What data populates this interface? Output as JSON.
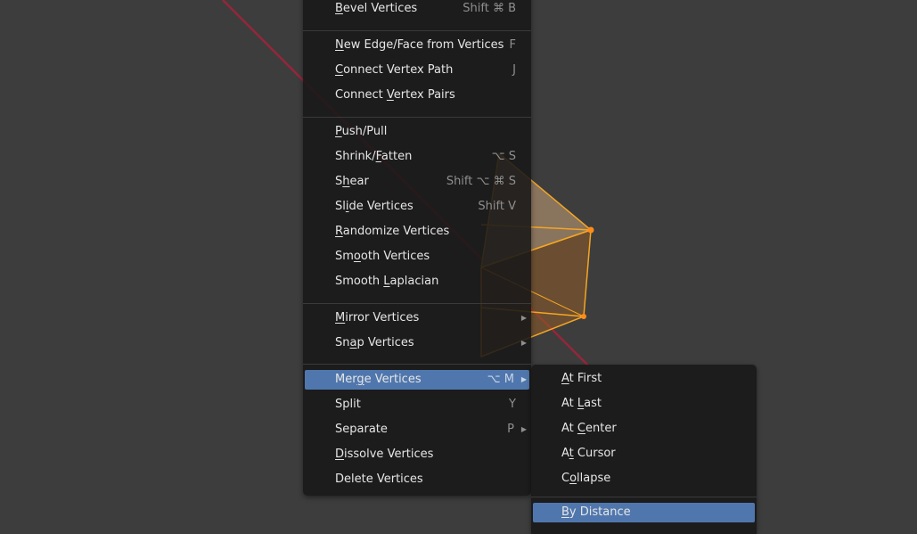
{
  "viewport": {
    "background": "#3d3d3d",
    "axis_color": "#a0243a",
    "mesh_color": "#f5a623"
  },
  "main_menu": {
    "items": [
      {
        "label": "Bevel Vertices",
        "mnemonic": "B",
        "shortcut": "Shift ⌘ B"
      },
      {
        "label": "New Edge/Face from Vertices",
        "mnemonic": "N",
        "shortcut": "F"
      },
      {
        "label": "Connect Vertex Path",
        "mnemonic": "C",
        "shortcut": "J"
      },
      {
        "label": "Connect Vertex Pairs",
        "mnemonic": "V",
        "shortcut": ""
      },
      {
        "label": "Push/Pull",
        "mnemonic": "P",
        "shortcut": ""
      },
      {
        "label": "Shrink/Fatten",
        "mnemonic": "F",
        "shortcut": "⌥ S"
      },
      {
        "label": "Shear",
        "mnemonic": "h",
        "shortcut": "Shift ⌥ ⌘ S"
      },
      {
        "label": "Slide Vertices",
        "mnemonic": "i",
        "shortcut": "Shift V"
      },
      {
        "label": "Randomize Vertices",
        "mnemonic": "R",
        "shortcut": ""
      },
      {
        "label": "Smooth Vertices",
        "mnemonic": "o",
        "shortcut": ""
      },
      {
        "label": "Smooth Laplacian",
        "mnemonic": "L",
        "shortcut": ""
      },
      {
        "label": "Mirror Vertices",
        "mnemonic": "M",
        "shortcut": "",
        "submenu": true
      },
      {
        "label": "Snap Vertices",
        "mnemonic": "a",
        "shortcut": "",
        "submenu": true
      },
      {
        "label": "Merge Vertices",
        "mnemonic": "g",
        "shortcut": "⌥ M",
        "submenu": true,
        "active": true
      },
      {
        "label": "Split",
        "mnemonic": "",
        "shortcut": "Y"
      },
      {
        "label": "Separate",
        "mnemonic": "",
        "shortcut": "P",
        "submenu": true
      },
      {
        "label": "Dissolve Vertices",
        "mnemonic": "D",
        "shortcut": ""
      },
      {
        "label": "Delete Vertices",
        "mnemonic": "",
        "shortcut": ""
      }
    ]
  },
  "merge_submenu": {
    "items": [
      {
        "label": "At First",
        "mnemonic": "A"
      },
      {
        "label": "At Last",
        "mnemonic": "L"
      },
      {
        "label": "At Center",
        "mnemonic": "C"
      },
      {
        "label": "At Cursor",
        "mnemonic": "t"
      },
      {
        "label": "Collapse",
        "mnemonic": "o"
      },
      {
        "label": "By Distance",
        "mnemonic": "B",
        "active": true
      }
    ]
  },
  "icons": {
    "submenu_arrow": "▶"
  }
}
